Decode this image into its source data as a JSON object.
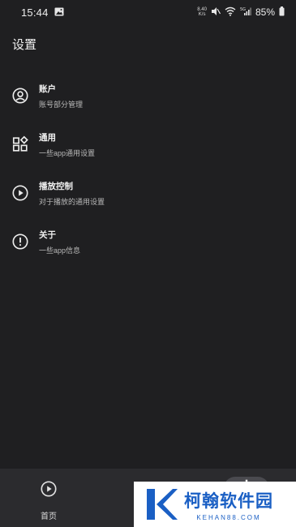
{
  "status_bar": {
    "time": "15:44",
    "net_speed_top": "8.40",
    "net_speed_bottom": "K/s",
    "battery": "85%"
  },
  "page": {
    "title": "设置"
  },
  "settings": [
    {
      "title": "账户",
      "subtitle": "账号部分管理",
      "icon": "account-circle-icon"
    },
    {
      "title": "通用",
      "subtitle": "一些app通用设置",
      "icon": "widgets-icon"
    },
    {
      "title": "播放控制",
      "subtitle": "对于播放的通用设置",
      "icon": "play-circle-icon"
    },
    {
      "title": "关于",
      "subtitle": "一些app信息",
      "icon": "info-circle-icon"
    }
  ],
  "bottom_nav": {
    "home_label": "首页",
    "items": [
      "home-icon",
      "library-icon",
      "settings-gear-icon"
    ],
    "active": "settings"
  },
  "watermark": {
    "title": "柯翰软件园",
    "sub": "KEHAN88.COM"
  },
  "colors": {
    "background": "#1f1f21",
    "bottom_nav": "#2b2b2e",
    "text_primary": "#f0f0f0",
    "text_secondary": "#b9b9b9",
    "watermark_blue": "#1a5fc4"
  }
}
